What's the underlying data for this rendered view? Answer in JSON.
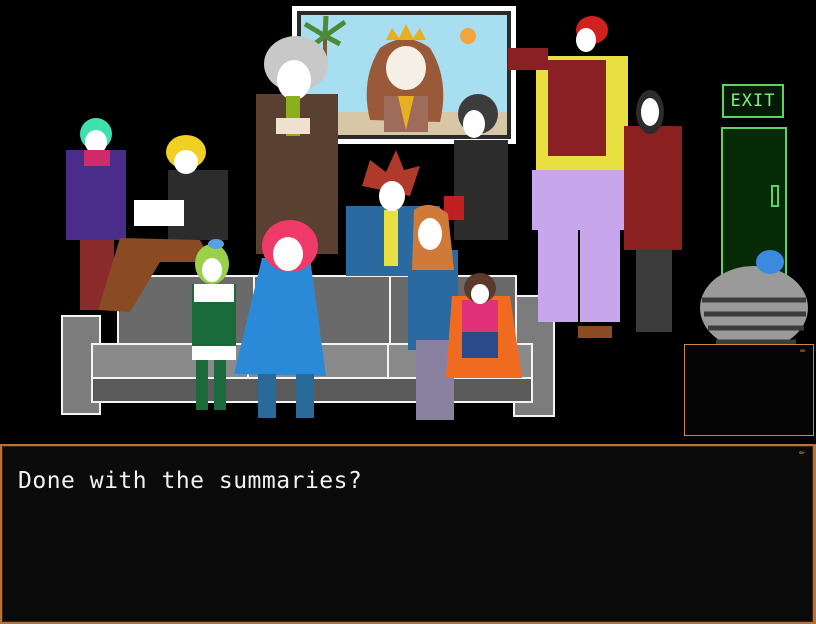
{
  "scene": {
    "exit_sign": "EXIT"
  },
  "dialogue": {
    "text": "Done with the summaries?"
  }
}
